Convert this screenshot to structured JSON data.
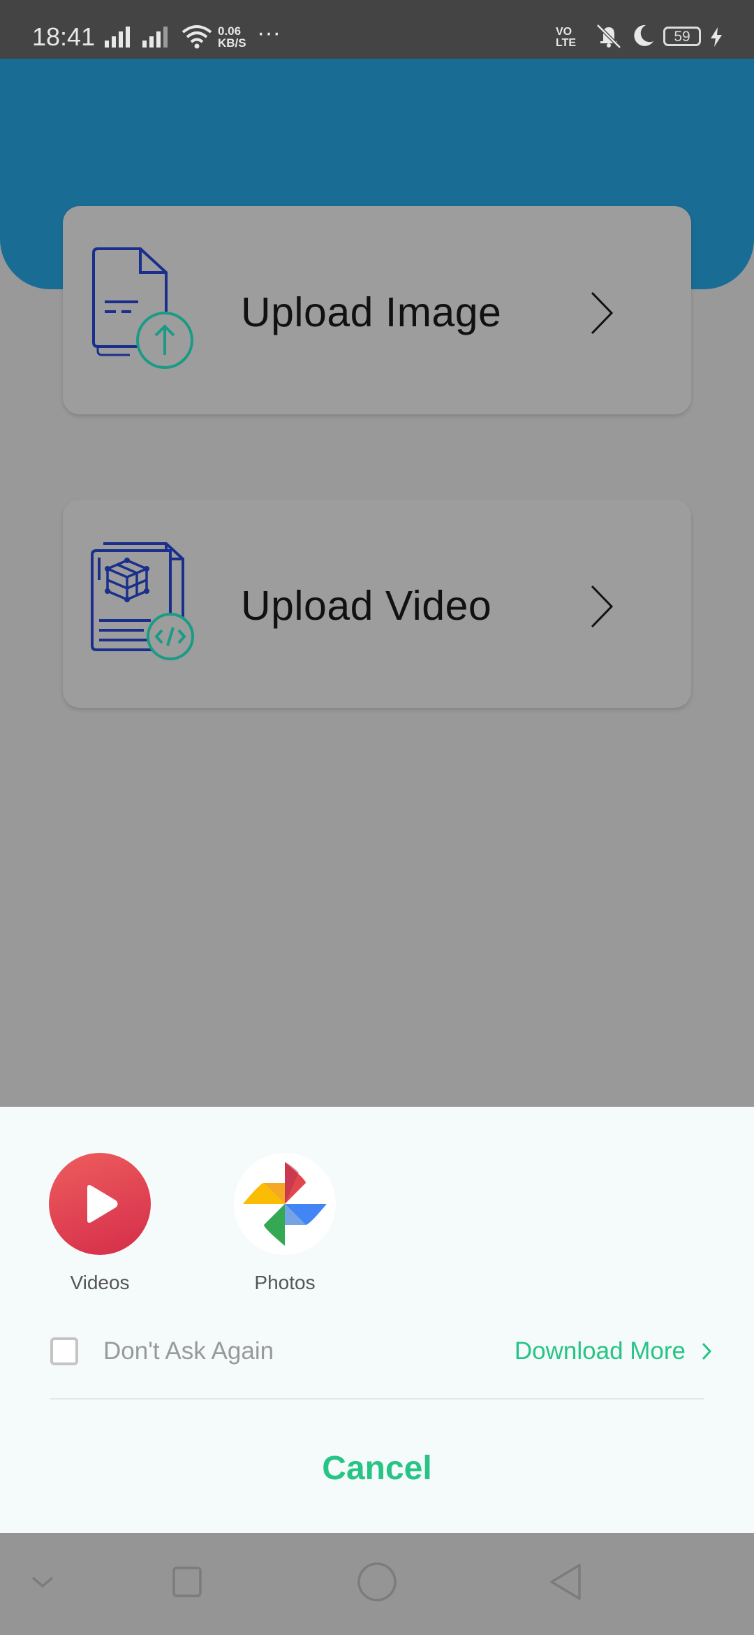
{
  "status_bar": {
    "time": "18:41",
    "net_speed_value": "0.06",
    "net_speed_unit": "KB/S",
    "more_dots": "···",
    "volte_top": "VO",
    "volte_bottom": "LTE",
    "battery": "59"
  },
  "cards": {
    "upload_image": {
      "label": "Upload Image",
      "icon": "upload-image-document-icon"
    },
    "upload_video": {
      "label": "Upload Video",
      "icon": "upload-video-document-icon"
    }
  },
  "chooser": {
    "apps": [
      {
        "name": "Videos",
        "icon": "play-icon"
      },
      {
        "name": "Photos",
        "icon": "pinwheel-icon"
      }
    ],
    "dont_ask_again": "Don't Ask Again",
    "dont_ask_checked": false,
    "download_more": "Download More",
    "cancel": "Cancel"
  },
  "colors": {
    "accent_green": "#27c485",
    "header_blue": "#196c94",
    "icon_navy": "#1a2f8c",
    "icon_teal": "#1a9b85"
  }
}
